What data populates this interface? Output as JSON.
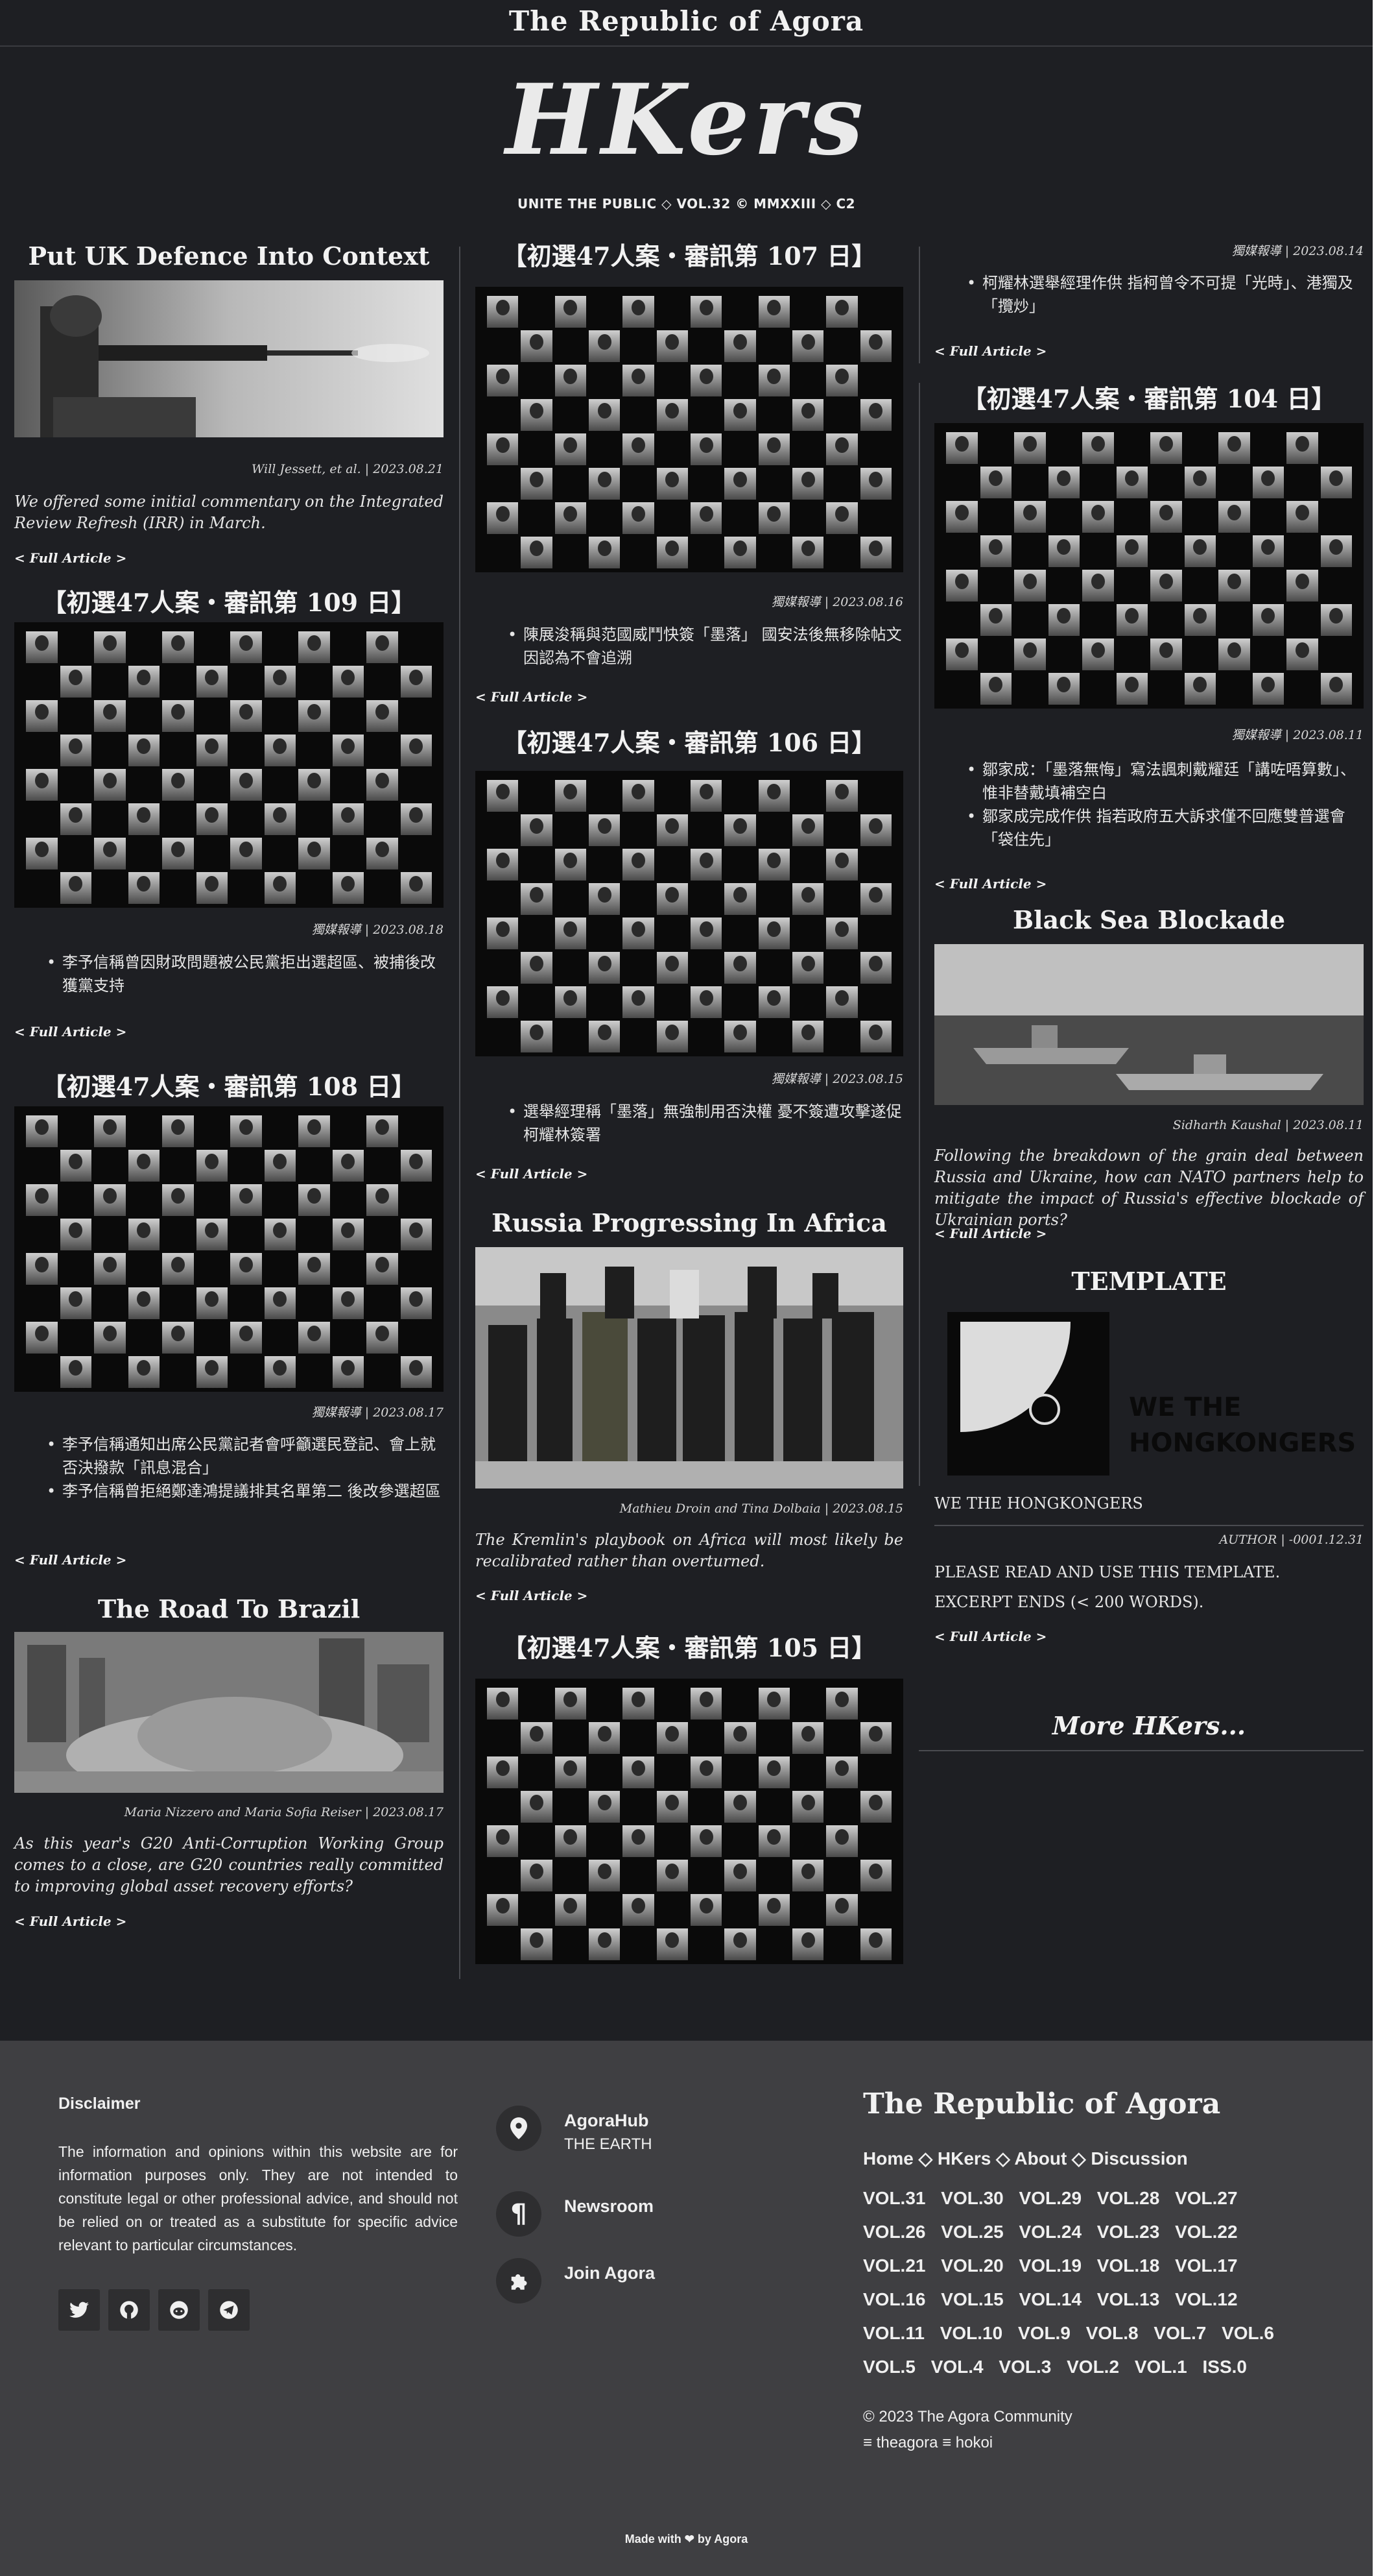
{
  "site": {
    "top_title": "The Republic of Agora",
    "masthead": "HKers",
    "tagline": "UNITE THE PUBLIC ◇ VOL.32 © MMXXIII ◇ C2"
  },
  "common": {
    "full_article": "< Full Article >"
  },
  "columns": {
    "col1": [
      {
        "title": "Put UK Defence Into Context",
        "byline": "Will Jessett, et al. | 2023.08.21",
        "excerpt": "We offered some initial commentary on the Integrated Review Refresh (IRR) in March."
      },
      {
        "title": "【初選47人案・審訊第 109 日】",
        "byline": "獨媒報導 | 2023.08.18",
        "bullets": [
          "李予信稱曾因財政問題被公民黨拒出選超區、被捕後改獲黨支持"
        ]
      },
      {
        "title": "【初選47人案・審訊第 108 日】",
        "byline": "獨媒報導 | 2023.08.17",
        "bullets": [
          "李予信稱通知出席公民黨記者會呼籲選民登記、會上就否決撥款「訊息混合」",
          "李予信稱曾拒絕鄭達鴻提議排其名單第二 後改參選超區"
        ]
      },
      {
        "title": "The Road To Brazil",
        "byline": "Maria Nizzero and Maria Sofia Reiser | 2023.08.17",
        "excerpt": "As this year's G20 Anti-Corruption Working Group comes to a close, are G20 countries really committed to improving global asset recovery efforts?"
      }
    ],
    "col2": [
      {
        "title": "【初選47人案・審訊第 107 日】",
        "byline": "獨媒報導 | 2023.08.16",
        "bullets": [
          "陳展浚稱與范國威鬥快簽「墨落」 國安法後無移除帖文 因認為不會追溯"
        ]
      },
      {
        "title": "【初選47人案・審訊第 106 日】",
        "byline": "獨媒報導 | 2023.08.15",
        "bullets": [
          "選舉經理稱「墨落」無強制用否決權 憂不簽遭攻擊遂促柯耀林簽署"
        ]
      },
      {
        "title": "Russia Progressing In Africa",
        "byline": "Mathieu Droin and Tina Dolbaia | 2023.08.15",
        "excerpt": "The Kremlin's playbook on Africa will most likely be recalibrated rather than overturned."
      },
      {
        "title": "【初選47人案・審訊第 105 日】"
      }
    ],
    "col3": [
      {
        "byline": "獨媒報導 | 2023.08.14",
        "bullets": [
          "柯耀林選舉經理作供 指柯曾令不可提「光時」、港獨及「攬炒」"
        ]
      },
      {
        "title": "【初選47人案・審訊第 104 日】",
        "byline": "獨媒報導 | 2023.08.11",
        "bullets": [
          "鄒家成：「墨落無悔」寫法諷刺戴耀廷「講咗唔算數」、惟非替戴填補空白",
          "鄒家成完成作供 指若政府五大訴求僅不回應雙普選會「袋住先」"
        ]
      },
      {
        "title": "Black Sea Blockade",
        "byline": "Sidharth Kaushal | 2023.08.11",
        "excerpt": "Following the breakdown of the grain deal between Russia and Ukraine, how can NATO partners help to mitigate the impact of Russia's effective blockade of Ukrainian ports?"
      },
      {
        "title": "TEMPLATE",
        "image_text": "WE THE HONGKONGERS",
        "caption": "WE THE HONGKONGERS",
        "byline": "AUTHOR | -0001.12.31",
        "lines": [
          "PLEASE READ AND USE THIS TEMPLATE.",
          "EXCERPT ENDS (< 200 WORDS)."
        ]
      }
    ],
    "more": "More HKers..."
  },
  "footer": {
    "disclaimer_title": "Disclaimer",
    "disclaimer_text": "The information and opinions within this website are for information purposes only. They are not intended to constitute legal or other professional advice, and should not be relied on or treated as a substitute for specific advice relevant to particular circumstances.",
    "socials": [
      "twitter-icon",
      "github-icon",
      "reddit-icon",
      "telegram-icon"
    ],
    "contacts": [
      {
        "label": "AgoraHub",
        "sub": "THE EARTH",
        "icon": "location-pin-icon"
      },
      {
        "label": "Newsroom",
        "icon": "pilcrow-icon"
      },
      {
        "label": "Join Agora",
        "icon": "puzzle-icon"
      }
    ],
    "brand": "The Republic of Agora",
    "nav": "Home ◇ HKers ◇ About ◇ Discussion",
    "vols": [
      "VOL.31",
      "VOL.30",
      "VOL.29",
      "VOL.28",
      "VOL.27",
      "VOL.26",
      "VOL.25",
      "VOL.24",
      "VOL.23",
      "VOL.22",
      "VOL.21",
      "VOL.20",
      "VOL.19",
      "VOL.18",
      "VOL.17",
      "VOL.16",
      "VOL.15",
      "VOL.14",
      "VOL.13",
      "VOL.12",
      "VOL.11",
      "VOL.10",
      "VOL.9",
      "VOL.8",
      "VOL.7",
      "VOL.6",
      "VOL.5",
      "VOL.4",
      "VOL.3",
      "VOL.2",
      "VOL.1",
      "ISS.0"
    ],
    "copyright": "© 2023 The Agora Community",
    "links": "≡ theagora ≡ hokoi",
    "made_by": "Made with ❤ by Agora"
  },
  "colors": {
    "page_bg": "#1e1f23",
    "footer_bg": "#3f3f42",
    "text": "#e6e6e6"
  }
}
